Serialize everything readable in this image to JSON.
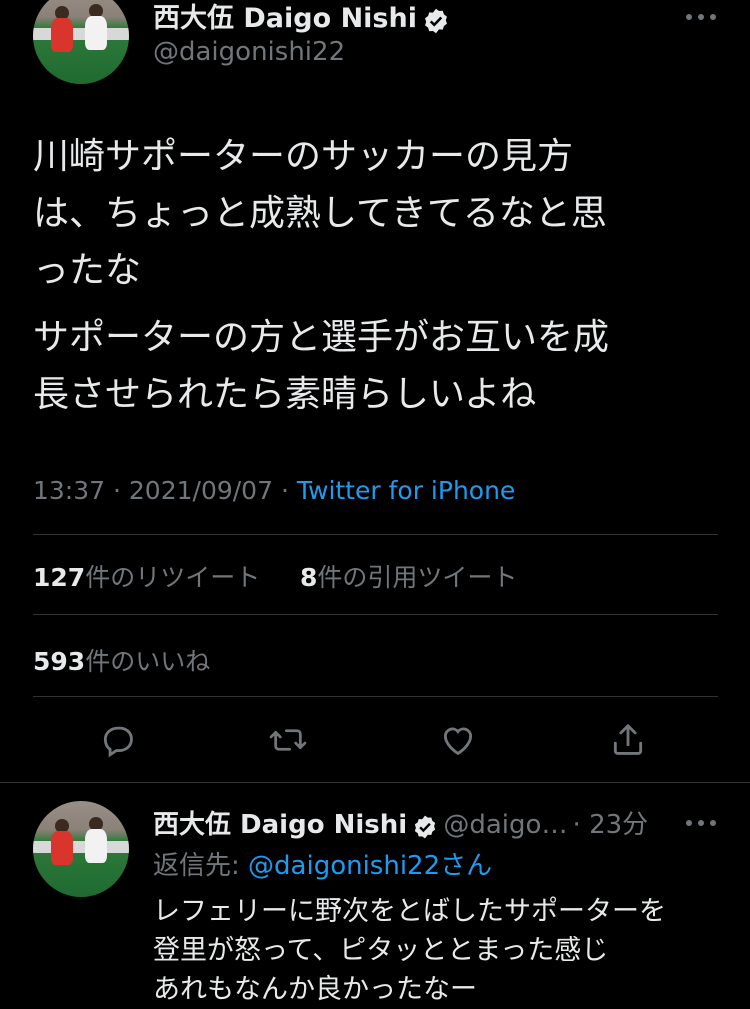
{
  "tweet": {
    "author_name": "西大伍 Daigo Nishi",
    "handle": "@daigonishi22",
    "text_paragraph_1_lines": [
      "川崎サポーターのサッカーの見方",
      "は、ちょっと成熟してきてるなと思",
      "ったな"
    ],
    "text_paragraph_2_lines": [
      "サポーターの方と選手がお互いを成",
      "長させられたら素晴らしいよね"
    ],
    "time": "13:37",
    "separator": "·",
    "date": "2021/09/07",
    "source": "Twitter for iPhone",
    "retweet_count": "127",
    "retweet_label": "件のリツイート",
    "quote_count": "8",
    "quote_label": "件の引用ツイート",
    "like_count": "593",
    "like_label": "件のいいね",
    "more_icon": "more-dots-icon"
  },
  "actions": {
    "icons": [
      "reply-icon",
      "retweet-icon",
      "like-icon",
      "share-icon"
    ]
  },
  "reply": {
    "author_name": "西大伍 Daigo Nishi",
    "handle": "@daigo…",
    "time": "· 23分",
    "replying_prefix": "返信先: ",
    "replying_link": "@daigonishi22さん",
    "text_lines": [
      "レフェリーに野次をとばしたサポーターを",
      "登里が怒って、ピタッととまった感じ",
      "あれもなんか良かったなー"
    ]
  },
  "colors": {
    "background": "#000000",
    "text": "#e7e9ea",
    "secondary": "#71767b",
    "accent": "#1d9bf0",
    "divider": "#2f3336"
  }
}
